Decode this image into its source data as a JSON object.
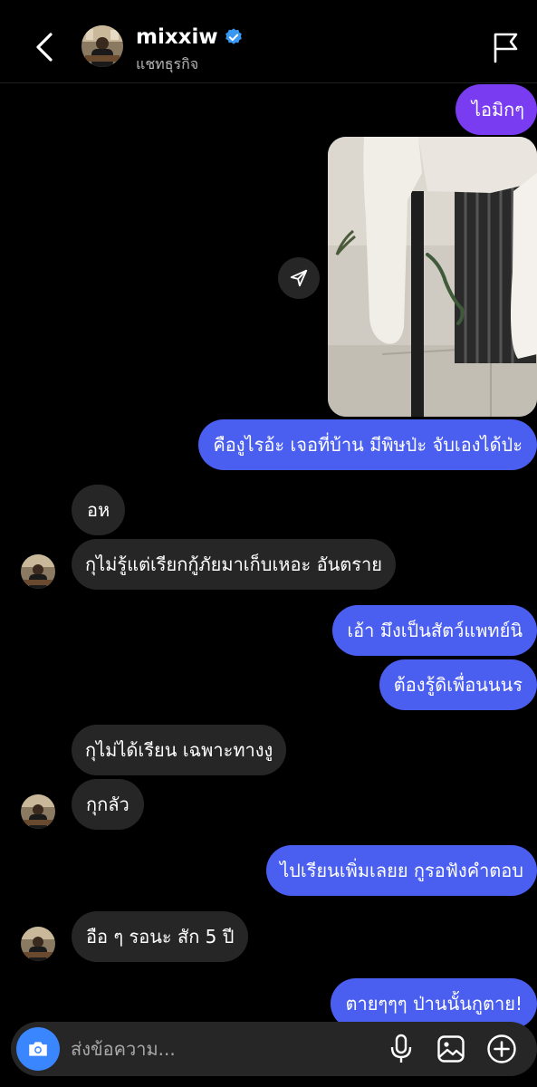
{
  "header": {
    "username": "mixxiw",
    "subtitle": "แชทธุรกิจ",
    "verified": true
  },
  "messages": [
    {
      "id": "m1",
      "direction": "out",
      "text": "ไอมิกๆ"
    },
    {
      "id": "m2",
      "direction": "out",
      "type": "photo"
    },
    {
      "id": "m3",
      "direction": "out",
      "text": "คืองูไรอ้ะ เจอที่บ้าน มีพิษป่ะ จับเองได้ป่ะ"
    },
    {
      "id": "m4",
      "direction": "in",
      "text": "อห"
    },
    {
      "id": "m5",
      "direction": "in",
      "text": "กุไม่รู้แต่เรียกกู้ภัยมาเก็บเหอะ อันตราย"
    },
    {
      "id": "m6",
      "direction": "out",
      "text": "เอ้า มึงเป็นสัตว์แพทย์นิ"
    },
    {
      "id": "m7",
      "direction": "out",
      "text": "ต้องรู้ดิเพื่อนนนร"
    },
    {
      "id": "m8",
      "direction": "in",
      "text": "กุไม่ได้เรียน เฉพาะทางงู"
    },
    {
      "id": "m9",
      "direction": "in",
      "text": "กุกลัว"
    },
    {
      "id": "m10",
      "direction": "out",
      "text": "ไปเรียนเพิ่มเลยย กูรอฟังคำตอบ"
    },
    {
      "id": "m11",
      "direction": "in",
      "text": "อือ ๆ รอนะ สัก 5 ปี"
    },
    {
      "id": "m12",
      "direction": "out",
      "text": "ตายๆๆๆ ป่านนั้นกูตาย!"
    }
  ],
  "composer": {
    "placeholder": "ส่งข้อความ..."
  },
  "colors": {
    "outgoing": "#4a5ef0",
    "outgoing_top": "#7a3cf0",
    "incoming": "#262626",
    "camera": "#3a86ff",
    "verified": "#3897f0"
  },
  "icons": [
    "back-arrow-icon",
    "verified-badge-icon",
    "flag-icon",
    "share-icon",
    "camera-icon",
    "microphone-icon",
    "gallery-icon",
    "plus-icon"
  ]
}
